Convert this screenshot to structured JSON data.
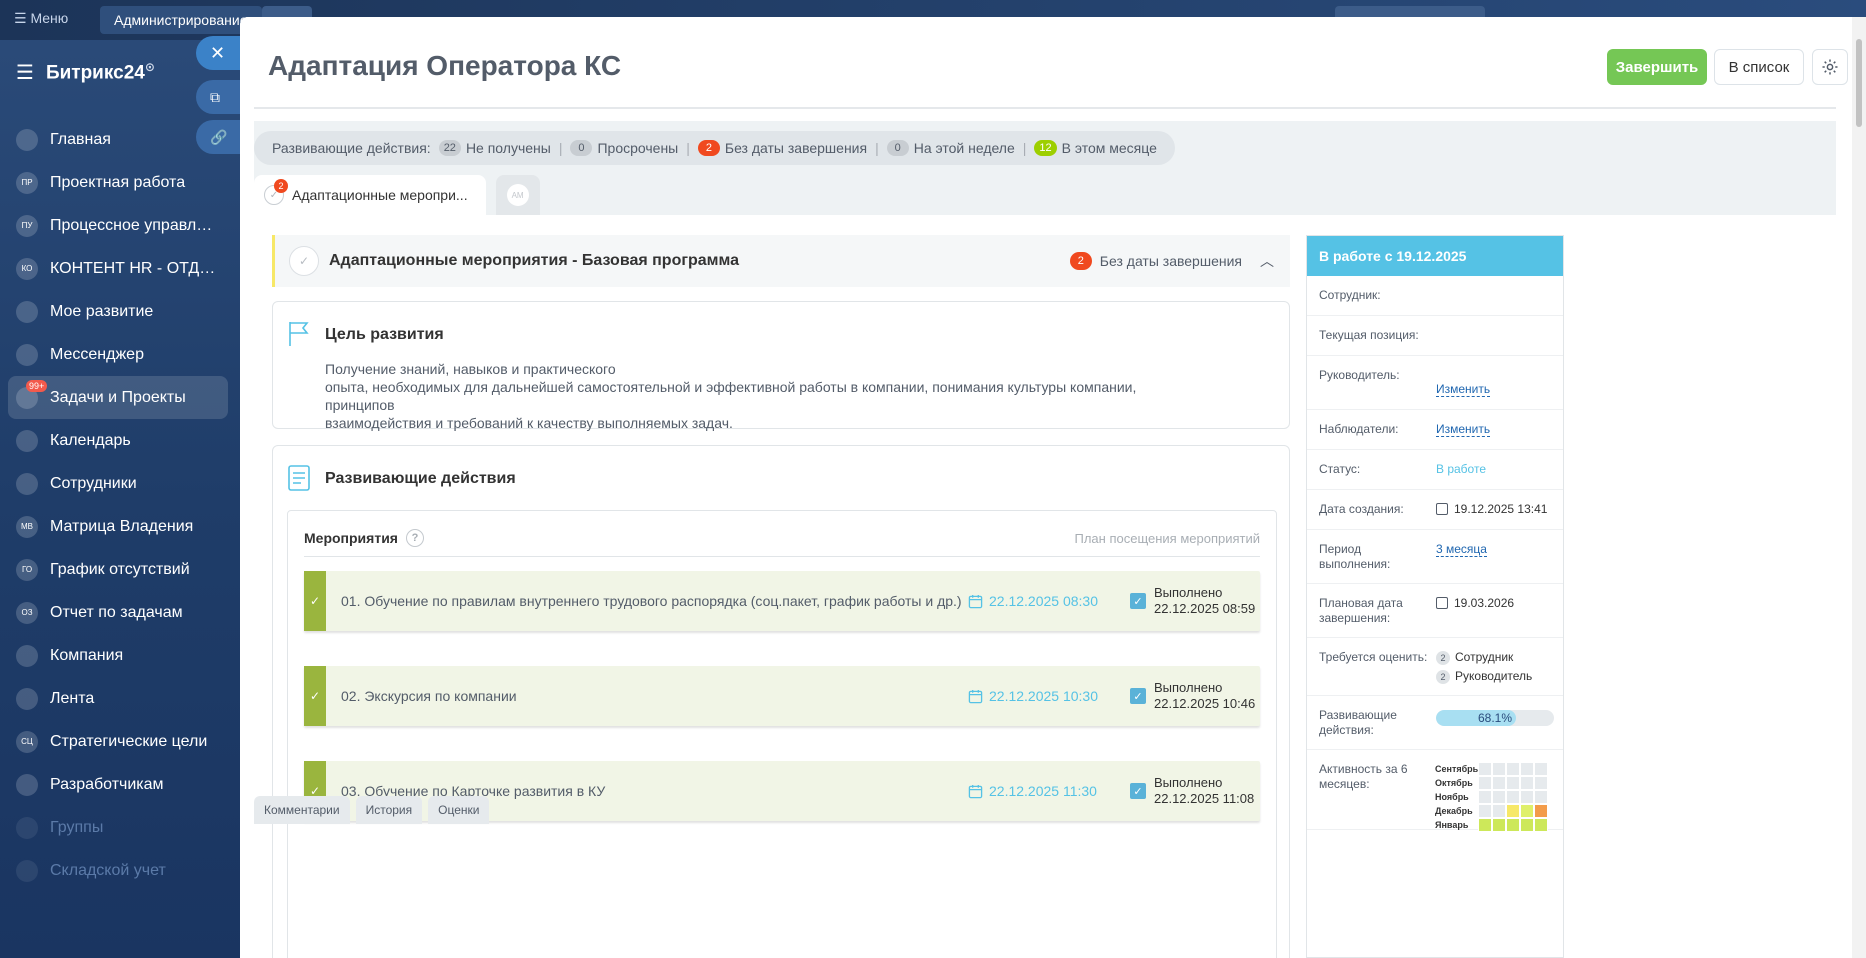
{
  "topbar": {
    "menu_label": "Меню",
    "admin_label": "Администрирование"
  },
  "sidebar": {
    "logo": "Битрикс24",
    "items": [
      {
        "abbr": "",
        "label": "Главная",
        "icon": "home-icon"
      },
      {
        "abbr": "ПР",
        "label": "Проектная работа"
      },
      {
        "abbr": "ПУ",
        "label": "Процессное управлен..."
      },
      {
        "abbr": "КО",
        "label": "КОНТЕНТ HR - ОТДЕЛА"
      },
      {
        "abbr": "",
        "label": "Мое развитие",
        "icon": "graduation-icon"
      },
      {
        "abbr": "",
        "label": "Мессенджер",
        "icon": "chat-icon"
      },
      {
        "abbr": "",
        "label": "Задачи и Проекты",
        "icon": "tasks-icon",
        "badge": "99+"
      },
      {
        "abbr": "",
        "label": "Календарь",
        "icon": "calendar-icon"
      },
      {
        "abbr": "",
        "label": "Сотрудники",
        "icon": "people-icon"
      },
      {
        "abbr": "МВ",
        "label": "Матрица Владения"
      },
      {
        "abbr": "ГО",
        "label": "График отсутствий"
      },
      {
        "abbr": "ОЗ",
        "label": "Отчет по задачам"
      },
      {
        "abbr": "",
        "label": "Компания",
        "icon": "company-icon"
      },
      {
        "abbr": "",
        "label": "Лента",
        "icon": "feed-icon"
      },
      {
        "abbr": "СЦ",
        "label": "Стратегические цели"
      },
      {
        "abbr": "",
        "label": "Разработчикам",
        "icon": "code-icon"
      },
      {
        "abbr": "",
        "label": "Группы",
        "icon": "groups-icon"
      },
      {
        "abbr": "",
        "label": "Складской учет",
        "icon": "warehouse-icon"
      }
    ]
  },
  "page": {
    "title": "Адаптация Оператора КС",
    "finish_label": "Завершить",
    "list_label": "В список"
  },
  "stats": {
    "label": "Развивающие действия:",
    "items": [
      {
        "count": "22",
        "label": "Не получены",
        "color": "gray"
      },
      {
        "count": "0",
        "label": "Просрочены",
        "color": "gray"
      },
      {
        "count": "2",
        "label": "Без даты завершения",
        "color": "red"
      },
      {
        "count": "0",
        "label": "На этой неделе",
        "color": "gray"
      },
      {
        "count": "12",
        "label": "В этом месяце",
        "color": "green"
      }
    ]
  },
  "tabs": {
    "active_label": "Адаптационные меропри...",
    "active_badge": "2",
    "inactive_avatar": "АМ"
  },
  "section": {
    "title": "Адаптационные мероприятия - Базовая программа",
    "count": "2",
    "count_label": "Без даты завершения"
  },
  "goal": {
    "title": "Цель развития",
    "lines": [
      "Получение знаний, навыков и практического",
      "опыта, необходимых для дальнейшей самостоятельной и эффективной работы в компании, понимания культуры компании, принципов",
      "взаимодействия и требований к качеству выполняемых задач."
    ]
  },
  "actions": {
    "title": "Развивающие действия",
    "events_title": "Мероприятия",
    "help": "?",
    "plan_link": "План посещения мероприятий",
    "rows": [
      {
        "name": "01. Обучение по правилам внутреннего трудового распорядка (соц.пакет, график работы и др.)",
        "date": "22.12.2025 08:30",
        "status": "Выполнено",
        "done_at": "22.12.2025 08:59"
      },
      {
        "name": "02. Экскурсия по компании",
        "date": "22.12.2025 10:30",
        "status": "Выполнено",
        "done_at": "22.12.2025 10:46"
      },
      {
        "name": "03. Обучение по Карточке развития в КУ",
        "date": "22.12.2025 11:30",
        "status": "Выполнено",
        "done_at": "22.12.2025 11:08"
      }
    ]
  },
  "bottom_tabs": [
    "Комментарии",
    "История",
    "Оценки"
  ],
  "info": {
    "header": "В работе с 19.12.2025",
    "employee_label": "Сотрудник:",
    "position_label": "Текущая позиция:",
    "manager_label": "Руководитель:",
    "change_label": "Изменить",
    "observers_label": "Наблюдатели:",
    "status_label": "Статус:",
    "status_value": "В работе",
    "created_label": "Дата создания:",
    "created_value": "19.12.2025 13:41",
    "period_label": "Период выполнения:",
    "period_value": "3 месяца",
    "plan_end_label": "Плановая дата завершения:",
    "plan_end_value": "19.03.2026",
    "rate_label": "Требуется оценить:",
    "rate_items": [
      {
        "count": "2",
        "label": "Сотрудник"
      },
      {
        "count": "2",
        "label": "Руководитель"
      }
    ],
    "progress_label": "Развивающие действия:",
    "progress_value": "68.1%",
    "progress_fraction": 0.681,
    "activity_label": "Активность за 6 месяцев:",
    "activity_months": [
      {
        "name": "Сентябрь",
        "cells": [
          "#e6eaed",
          "#e6eaed",
          "#e6eaed",
          "#e6eaed",
          "#e6eaed"
        ]
      },
      {
        "name": "Октябрь",
        "cells": [
          "#e6eaed",
          "#e6eaed",
          "#e6eaed",
          "#e6eaed",
          "#e6eaed"
        ]
      },
      {
        "name": "Ноябрь",
        "cells": [
          "#e6eaed",
          "#e6eaed",
          "#e6eaed",
          "#e6eaed",
          "#e6eaed"
        ]
      },
      {
        "name": "Декабрь",
        "cells": [
          "#e6eaed",
          "#e6eaed",
          "#f7e867",
          "#dff06a",
          "#f39c4a"
        ]
      },
      {
        "name": "Январь",
        "cells": [
          "#cde85a",
          "#cde85a",
          "#cde85a",
          "#cde85a",
          "#cde85a"
        ]
      }
    ]
  }
}
